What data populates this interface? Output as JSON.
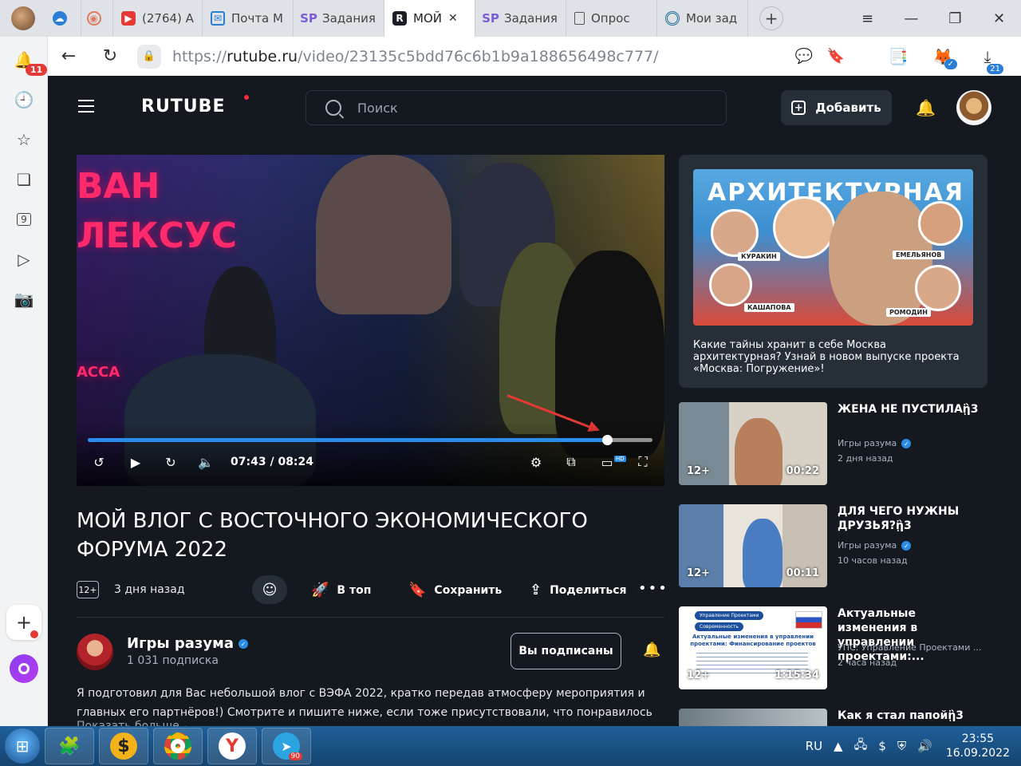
{
  "browser": {
    "tabs": [
      {
        "label": "",
        "icon": "cloud-icon"
      },
      {
        "label": "",
        "icon": "app-icon"
      },
      {
        "label": "(2764) A",
        "icon": "youtube-icon"
      },
      {
        "label": "Почта М",
        "icon": "mail-icon"
      },
      {
        "label": "Задания",
        "icon": "sp-icon"
      },
      {
        "label": "МОЙ",
        "icon": "rutube-icon",
        "active": true
      },
      {
        "label": "Задания",
        "icon": "sp-icon"
      },
      {
        "label": "Опрос",
        "icon": "document-icon"
      },
      {
        "label": "Мои зад",
        "icon": "target-icon"
      }
    ],
    "url_prefix": "https://",
    "url_host": "rutube.ru",
    "url_path": "/video/23135c5bdd76c6b1b9a188656498c777/",
    "sidebar_badge": "11",
    "downloads_badge": "21"
  },
  "header": {
    "logo": "RUTUBE",
    "search_placeholder": "Поиск",
    "add_label": "Добавить"
  },
  "player": {
    "overlay_text_1": "ВАН",
    "overlay_text_2": "ЛЕКСУС",
    "overlay_text_3": "АССА",
    "current_time": "07:43",
    "duration": "08:24",
    "progress": 0.919,
    "hd_label": "HD"
  },
  "video": {
    "title": "МОЙ ВЛОГ С ВОСТОЧНОГО ЭКОНОМИЧЕСКОГО ФОРУМА 2022",
    "age": "12+",
    "date": "3 дня назад",
    "actions": {
      "top": "В топ",
      "save": "Сохранить",
      "share": "Поделиться"
    },
    "channel": {
      "name": "Игры разума",
      "subscribers": "1 031 подписка",
      "subscribe_state": "Вы подписаны"
    },
    "description": "Я подготовил для Вас небольшой влог с ВЭФА 2022, кратко передав атмосферу мероприятия и главных его партнёров!) Смотрите и пишите ниже, если тоже присутствовали, что понравилось больше всего! Либо вы...",
    "show_more": "Показать больше"
  },
  "promo": {
    "headline": "АРХИТЕКТУРНАЯ",
    "people": [
      "КУРАКИН",
      "ЕМЕЛЬЯНОВ",
      "КАШАПОВА",
      "РОМОДИН"
    ],
    "text": "Какие тайны хранит в себе Москва архитектурная? Узнай в новом выпуске проекта «Москва: Погружение»!"
  },
  "recommendations": [
    {
      "title": "ЖЕНА НЕ ПУСТИЛАᾒ3",
      "channel": "Игры разума",
      "time": "2 дня назад",
      "age": "12+",
      "duration": "00:22"
    },
    {
      "title": "ДЛЯ ЧЕГО НУЖНЫ ДРУЗЬЯ?ᾒ3",
      "channel": "Игры разума",
      "time": "10 часов назад",
      "age": "12+",
      "duration": "00:11"
    },
    {
      "title": "Актуальные изменения в управлении проектами:...",
      "channel": "УПС: Управление Проектами ...",
      "time": "2 часа назад",
      "age": "12+",
      "duration": "1:15:34",
      "thumb_head": "Актуальные изменения в управлении проектами: Финансирование проектов",
      "thumb_tags": [
        "Управление Проектами",
        "Современность"
      ]
    },
    {
      "title": "Как я стал папойᾒ3",
      "channel": "",
      "time": "",
      "age": "",
      "duration": ""
    }
  ],
  "taskbar": {
    "telegram_badge": "90",
    "lang": "RU",
    "time": "23:55",
    "date": "16.09.2022"
  },
  "colors": {
    "accent": "#2a8ce8",
    "page_bg": "#14191f",
    "card_bg": "#262e38",
    "logo_dot": "#ff2e3c",
    "arrow": "#e53935"
  }
}
